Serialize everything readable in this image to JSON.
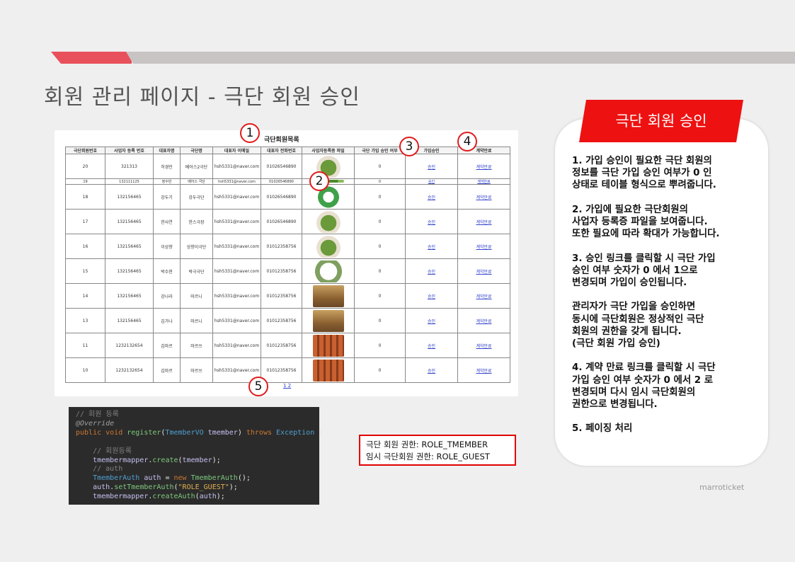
{
  "slide": {
    "title": "회원 관리 페이지 - 극단 회원 승인",
    "brand": "marroticket"
  },
  "screenshot": {
    "list_title": "극단회원목록",
    "headers": [
      "극단회원번호",
      "사업자 등록 번호",
      "대표자명",
      "극단명",
      "대표자 이메일",
      "대표자 전화번호",
      "사업자등록증 파일",
      "극단 가입 승인 여부",
      "가입승인",
      "계약만료"
    ],
    "rows": [
      {
        "no": "20",
        "biz": "321313",
        "rep": "허경민",
        "troupe": "베어스2극단",
        "email": "hsh5331@naver.com",
        "phone": "01026546890",
        "approved": "0",
        "approve_link": "승인",
        "expire_link": "계약만료",
        "thumb": "salad"
      },
      {
        "no": "19",
        "biz": "132111125",
        "rep": "정수빈",
        "troupe": "베어스 극단",
        "email": "hsh5331@naver.com",
        "phone": "01026546890",
        "approved": "0",
        "approve_link": "승인",
        "expire_link": "계약만료",
        "thumb": "green"
      },
      {
        "no": "18",
        "biz": "132156465",
        "rep": "강두기",
        "troupe": "강두극단",
        "email": "hsh5331@naver.com",
        "phone": "01026546890",
        "approved": "0",
        "approve_link": "승인",
        "expire_link": "계약만료",
        "thumb": "ring"
      },
      {
        "no": "17",
        "biz": "132156465",
        "rep": "한사연",
        "troupe": "한스극장",
        "email": "hsh5331@naver.com",
        "phone": "01026546890",
        "approved": "0",
        "approve_link": "승인",
        "expire_link": "계약만료",
        "thumb": "salad"
      },
      {
        "no": "16",
        "biz": "132156465",
        "rep": "이상향",
        "troupe": "상향이극단",
        "email": "hsh5331@naver.com",
        "phone": "01012358756",
        "approved": "0",
        "approve_link": "승인",
        "expire_link": "계약만료",
        "thumb": "salad"
      },
      {
        "no": "15",
        "biz": "132156465",
        "rep": "박수현",
        "troupe": "박극극단",
        "email": "hsh5331@naver.com",
        "phone": "01012358756",
        "approved": "0",
        "approve_link": "승인",
        "expire_link": "계약만료",
        "thumb": "frame"
      },
      {
        "no": "14",
        "biz": "132156465",
        "rep": "강나라",
        "troupe": "마르니",
        "email": "hsh5331@naver.com",
        "phone": "01012358756",
        "approved": "0",
        "approve_link": "승인",
        "expire_link": "계약만료",
        "thumb": "people"
      },
      {
        "no": "13",
        "biz": "132156465",
        "rep": "김가나",
        "troupe": "마르니",
        "email": "hsh5331@naver.com",
        "phone": "01012358756",
        "approved": "0",
        "approve_link": "승인",
        "expire_link": "계약만료",
        "thumb": "people"
      },
      {
        "no": "11",
        "biz": "1232132654",
        "rep": "김마르",
        "troupe": "마르쓰",
        "email": "hsh5331@naver.com",
        "phone": "01012358756",
        "approved": "0",
        "approve_link": "승인",
        "expire_link": "계약만료",
        "thumb": "skewer"
      },
      {
        "no": "10",
        "biz": "1232132654",
        "rep": "김마르",
        "troupe": "마르쓰",
        "email": "hsh5331@naver.com",
        "phone": "01012358756",
        "approved": "0",
        "approve_link": "승인",
        "expire_link": "계약만료",
        "thumb": "skewer"
      }
    ],
    "pager": "1 2"
  },
  "markers": [
    "1",
    "2",
    "3",
    "4",
    "5"
  ],
  "code_lines": [
    [
      [
        "c-com",
        "// 회원 등록"
      ]
    ],
    [
      [
        "c-ann",
        "@Override"
      ]
    ],
    [
      [
        "c-kw",
        "public void "
      ],
      [
        "c-fn",
        "register"
      ],
      [
        "c-plain",
        "("
      ],
      [
        "c-ty",
        "TmemberVO "
      ],
      [
        "c-var",
        "tmember"
      ],
      [
        "c-plain",
        ") "
      ],
      [
        "c-kw",
        "throws "
      ],
      [
        "c-ty",
        "Exception "
      ],
      [
        "c-plain",
        "{"
      ]
    ],
    [
      [
        "c-plain",
        ""
      ]
    ],
    [
      [
        "c-com",
        "    // 회원등록"
      ]
    ],
    [
      [
        "c-var",
        "    tmembermapper"
      ],
      [
        "c-plain",
        "."
      ],
      [
        "c-fn",
        "create"
      ],
      [
        "c-plain",
        "("
      ],
      [
        "c-var",
        "tmember"
      ],
      [
        "c-plain",
        ");"
      ]
    ],
    [
      [
        "c-com",
        "    // auth"
      ]
    ],
    [
      [
        "c-ty",
        "    TmemberAuth "
      ],
      [
        "c-var",
        "auth"
      ],
      [
        "c-plain",
        " = "
      ],
      [
        "c-kw",
        "new "
      ],
      [
        "c-fn",
        "TmemberAuth"
      ],
      [
        "c-plain",
        "();"
      ]
    ],
    [
      [
        "c-var",
        "    auth"
      ],
      [
        "c-plain",
        "."
      ],
      [
        "c-fn",
        "setTmemberAuth"
      ],
      [
        "c-plain",
        "("
      ],
      [
        "c-str",
        "\"ROLE_GUEST\""
      ],
      [
        "c-plain",
        ");"
      ]
    ],
    [
      [
        "c-var",
        "    tmembermapper"
      ],
      [
        "c-plain",
        "."
      ],
      [
        "c-fn",
        "createAuth"
      ],
      [
        "c-plain",
        "("
      ],
      [
        "c-var",
        "auth"
      ],
      [
        "c-plain",
        ");"
      ]
    ]
  ],
  "roles": {
    "line1": "극단 회원 권한: ROLE_TMEMBER",
    "line2": "임시 극단회원 권한: ROLE_GUEST"
  },
  "card": {
    "banner": "극단 회원 승인",
    "items": [
      "1. 가입 승인이 필요한 극단 회원의\n정보를 극단 가입 승인 여부가 0 인\n상태로 테이블 형식으로 뿌려줍니다.",
      "2. 가입에 필요한 극단회원의\n사업자 등록증 파일을 보여줍니다.\n또한 필요에 따라 확대가 가능합니다.",
      "3. 승인 링크를 클릭할 시 극단 가입\n승인 여부 숫자가 0 에서 1으로\n변경되며 가입이 승인됩니다.",
      " 관리자가 극단 가입을 승인하면\n동시에 극단회원은 정상적인 극단\n회원의 권한을 갖게 됩니다.\n(극단 회원 가입 승인)",
      "4. 계약 만료 링크를 클릭할 시 극단\n가입 승인 여부 숫자가 0 에서 2 로\n변경되며 다시 임시 극단회원의\n권한으로 변경됩니다.",
      "5. 페이징 처리"
    ]
  },
  "colors": {
    "accent_red": "#ee1111",
    "bar_red": "#e8505b",
    "bar_grey": "#c8c4c4",
    "link_blue": "#3344cc"
  }
}
